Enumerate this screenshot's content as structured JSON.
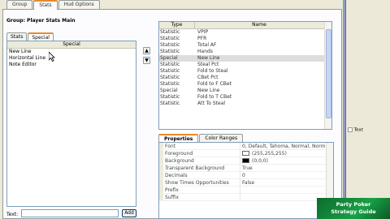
{
  "tabs": [
    "Group",
    "Stats",
    "Hud Options"
  ],
  "group_label": "Group: Player Stats Main",
  "sub_tabs": [
    "Stats",
    "Special"
  ],
  "left_list": {
    "header": "Special",
    "items": [
      "New Line",
      "Horizontal Line",
      "Note Editor"
    ]
  },
  "text_input": {
    "label": "Text:",
    "value": ""
  },
  "add_button": "Add",
  "stats_grid": {
    "columns": [
      "Type",
      "Name"
    ],
    "rows": [
      {
        "type": "Statistic",
        "name": "VPIP"
      },
      {
        "type": "Statistic",
        "name": "PFR"
      },
      {
        "type": "Statistic",
        "name": "Total AF"
      },
      {
        "type": "Statistic",
        "name": "Hands"
      },
      {
        "type": "Special",
        "name": "New Line"
      },
      {
        "type": "Statistic",
        "name": "Steal Pct"
      },
      {
        "type": "Statistic",
        "name": "Fold to Steal"
      },
      {
        "type": "Statistic",
        "name": "CBet Pct"
      },
      {
        "type": "Statistic",
        "name": "Fold to F CBet"
      },
      {
        "type": "Special",
        "name": "New Line"
      },
      {
        "type": "Statistic",
        "name": "Fold to T CBet"
      },
      {
        "type": "Statistic",
        "name": "Att To Steal"
      }
    ]
  },
  "prop_tabs": [
    "Properties",
    "Color Ranges"
  ],
  "properties": [
    {
      "name": "Font",
      "value": "0, Default, Tahoma, Normal, Norm",
      "color": ""
    },
    {
      "name": "Foreground",
      "value": "(255,255,255)",
      "color": "#ffffff"
    },
    {
      "name": "Background",
      "value": "(0,0,0)",
      "color": "#000000"
    },
    {
      "name": "Transparent Background",
      "value": "True",
      "color": ""
    },
    {
      "name": "Decimals",
      "value": "0",
      "color": ""
    },
    {
      "name": "Show Times Opportunities",
      "value": "False",
      "color": ""
    },
    {
      "name": "Prefix",
      "value": "",
      "color": ""
    },
    {
      "name": "Suffix",
      "value": "",
      "color": ""
    }
  ],
  "side_text": "Text",
  "logo": {
    "line1": "Party Poker",
    "line2": "Strategy Guide"
  }
}
